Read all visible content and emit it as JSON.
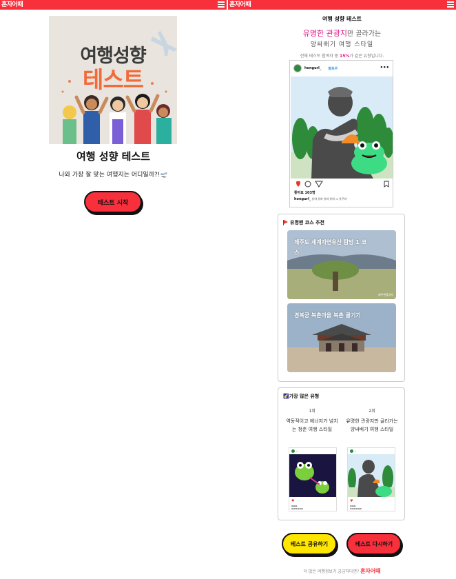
{
  "brand": "혼자어때",
  "colors": {
    "accent": "#f7303c",
    "highlight": "#e0178a",
    "share": "#ffe600"
  },
  "left": {
    "hero": {
      "line1": "여행성향",
      "line2": "테스트"
    },
    "title": "여행 성향 테스트",
    "subtitle": "나와 가장 잘 맞는 여행지는 어디일까?!🛫",
    "start_button": "테스트 시작"
  },
  "right": {
    "title": "여행 성향 테스트",
    "result_highlight": "유명한 관광지",
    "result_rest": "만 골라가는",
    "result_line2": "양싸배기 여행 스타일",
    "stat_prefix": "전체 테스트 참여자 중 ",
    "stat_percent": "15%",
    "stat_suffix": "가 같은 유형입니다.",
    "post": {
      "username": "hongurl_",
      "follow": "팔로우",
      "likes": "좋아요 103명",
      "caption_user": "hongurl_",
      "caption_text": "유야 유야 유야 유야 그 유구야"
    },
    "courses": {
      "heading": "유명맨 코스 추천",
      "items": [
        {
          "label": "제주도 세계자연유산 탐방 1 코스",
          "credit": "제주관광공사"
        },
        {
          "label": "경복궁 북촌마을 북촌 골기기",
          "credit": ""
        }
      ]
    },
    "popular": {
      "heading": "🌠가장 많은 유형",
      "ranks": [
        {
          "rank": "1위",
          "desc": "역동적이고 에너지가 넘치는 청춘 여행 스타일"
        },
        {
          "rank": "2위",
          "desc": "유명한 관광지만 골라가는 양싸배기 여행 스타일"
        }
      ]
    },
    "share_button": "테스트 공유하기",
    "retry_button": "테스트 다시하기",
    "footer_text": "더 많은 여행정보가 궁금하다면? ",
    "footer_brand": "혼자어때"
  }
}
